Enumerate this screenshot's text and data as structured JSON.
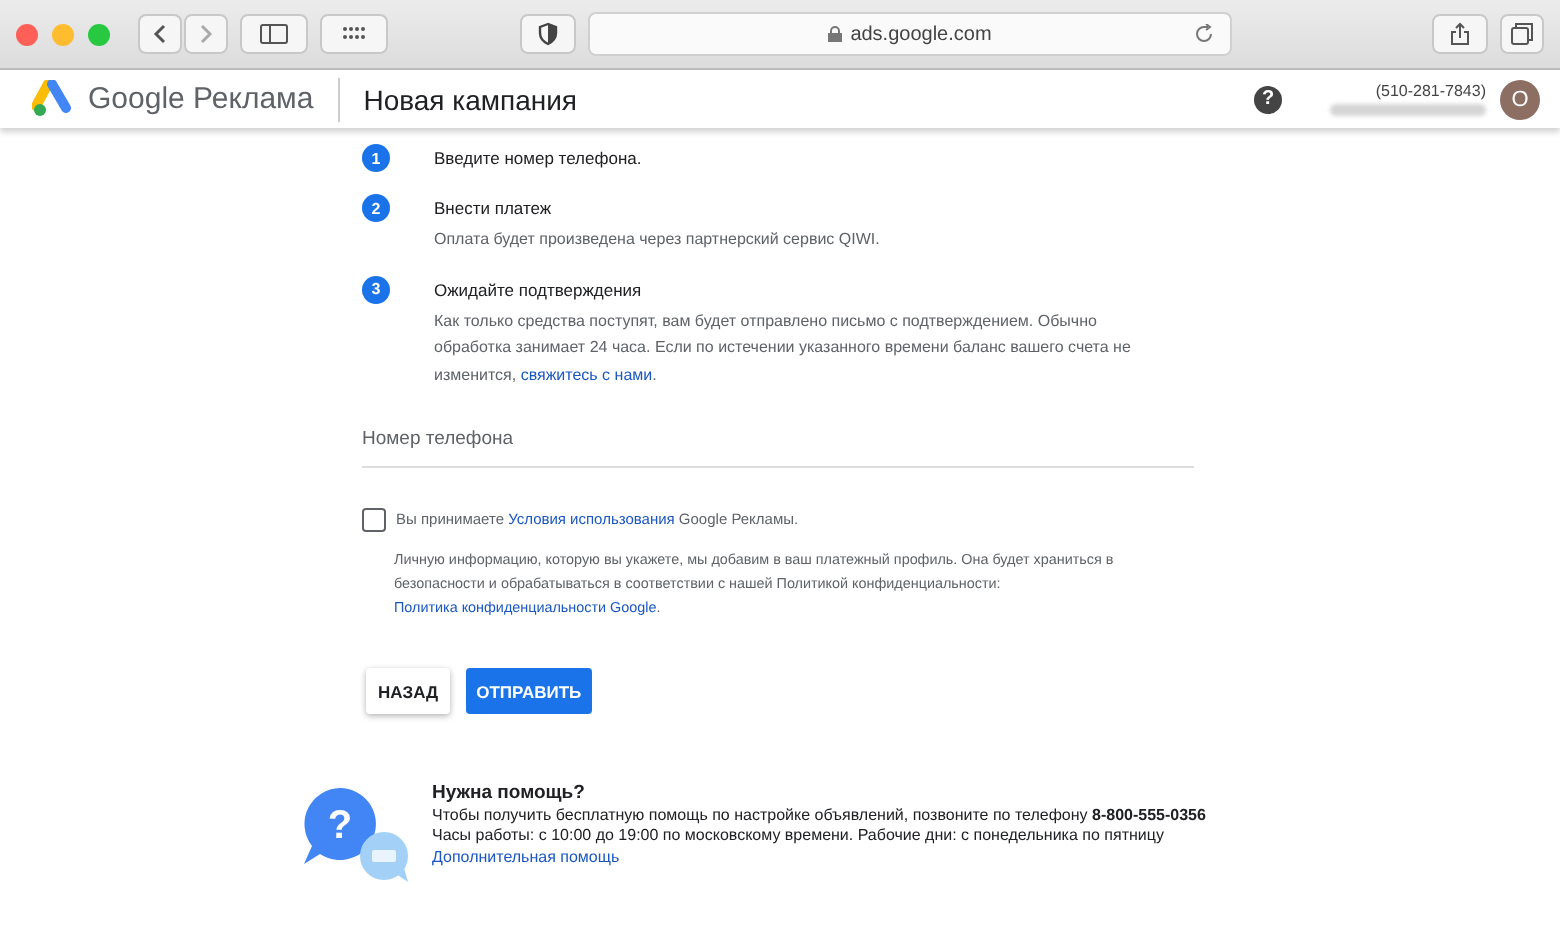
{
  "browser": {
    "url": "ads.google.com"
  },
  "header": {
    "brand_google": "Google",
    "brand_product": "Реклама",
    "page_title": "Новая кампания",
    "help": "?",
    "phone": "(510-281-7843)",
    "avatar": "O"
  },
  "steps": [
    {
      "number": "1",
      "title": "Введите номер телефона."
    },
    {
      "number": "2",
      "title": "Внести платеж",
      "text": "Оплата будет произведена через партнерский сервис QIWI."
    },
    {
      "number": "3",
      "title": "Ожидайте подтверждения",
      "text": "Как только средства поступят, вам будет отправлено письмо с подтверждением. Обычно обработка занимает 24 часа. Если по истечении указанного времени баланс вашего счета не изменится, ",
      "link": "свяжитесь с нами",
      "tail": "."
    }
  ],
  "phone_field": {
    "placeholder": "Номер телефона"
  },
  "terms": {
    "checked": false,
    "text": "Вы принимаете ",
    "link": "Условия использования",
    "tail": " Google Рекламы."
  },
  "privacy": {
    "text": "Личную информацию, которую вы укажете, мы добавим в ваш платежный профиль. Она будет храниться в безопасности и обрабатываться в соответствии с нашей Политикой конфиденциальности: ",
    "link": "Политика конфиденциальности Google",
    "tail": "."
  },
  "buttons": [
    {
      "label": "НАЗАД",
      "kind": "secondary"
    },
    {
      "label": "ОТПРАВИТЬ",
      "kind": "primary"
    }
  ],
  "help": {
    "icon_glyph": "?",
    "title": "Нужна помощь?",
    "line1": "Чтобы получить бесплатную помощь по настройке объявлений, позвоните по телефону **8-800-555-0356**",
    "line2": "Часы работы: с 10:00 до 19:00 по московскому времени. Рабочие дни: с понедельника по пятницу",
    "link": "Дополнительная помощь"
  }
}
